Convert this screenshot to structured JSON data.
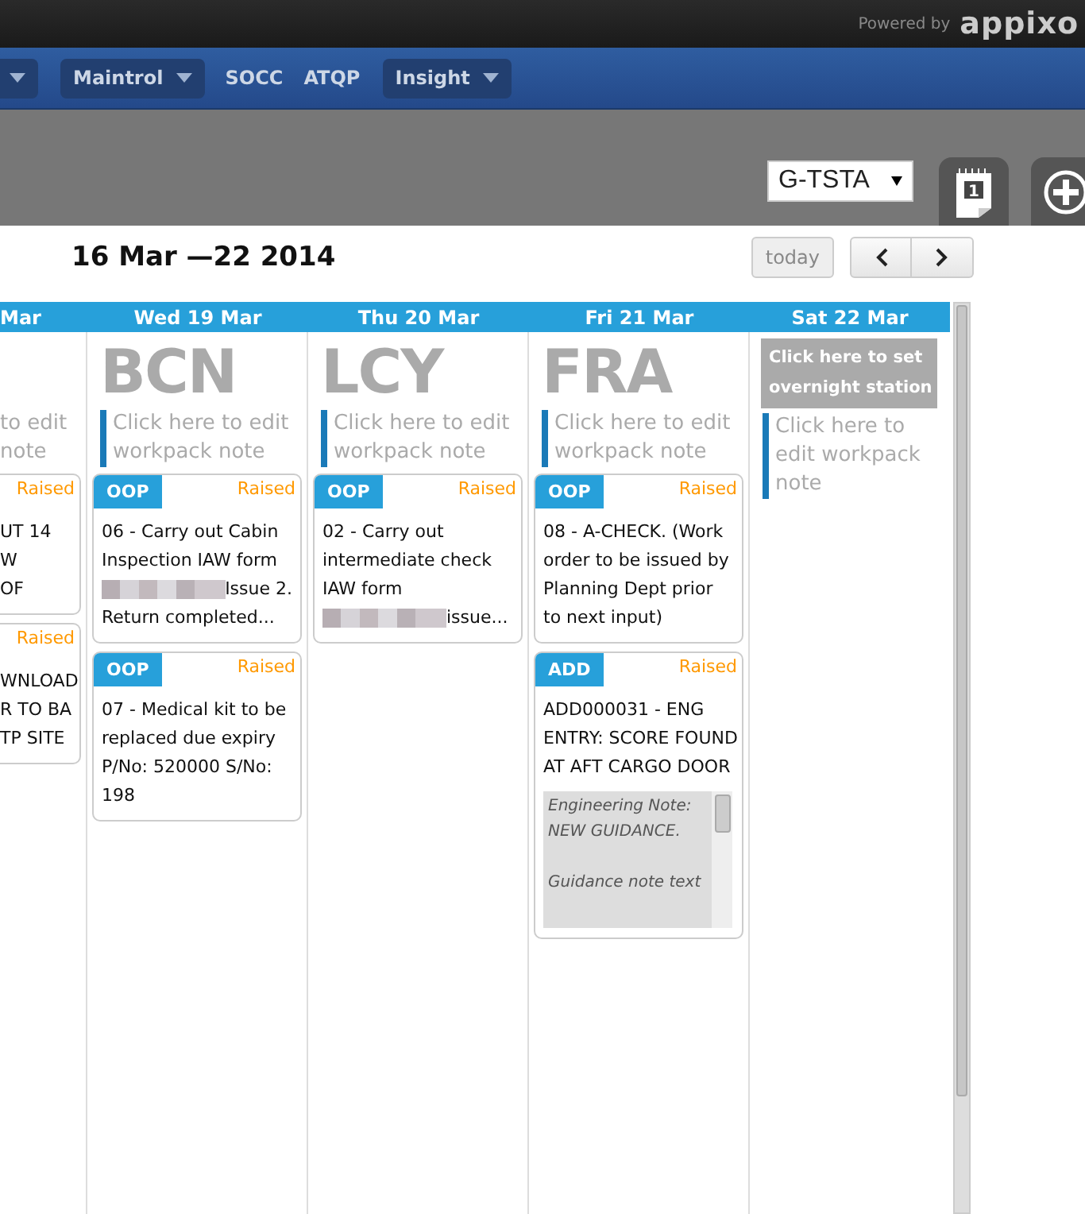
{
  "topbar": {
    "powered_by": "Powered by",
    "logo": "appixo"
  },
  "nav": [
    {
      "kind": "caret_only"
    },
    {
      "kind": "dropdown",
      "label": "Maintrol"
    },
    {
      "kind": "link",
      "label": "SOCC"
    },
    {
      "kind": "link",
      "label": "ATQP"
    },
    {
      "kind": "dropdown",
      "label": "Insight"
    }
  ],
  "toolbar": {
    "aircraft_select": "G-TSTA",
    "calendar_day": "1"
  },
  "title": "16 Mar —22 2014",
  "today_button": "today",
  "days": [
    {
      "kind": "cut",
      "header": "Mar",
      "note_lines": [
        "to edit",
        "note"
      ],
      "cards": [
        {
          "status": "Raised",
          "lines": [
            [
              "UT 14"
            ],
            [
              "W"
            ],
            [
              "OF"
            ]
          ]
        },
        {
          "status": "Raised",
          "lines": [
            [
              "WNLOAD"
            ],
            [
              "R TO BA"
            ],
            [
              "TP SITE"
            ]
          ]
        }
      ]
    },
    {
      "kind": "full",
      "header": "Wed 19 Mar",
      "station": "BCN",
      "note_lines": [
        "Click here to edit",
        "workpack note"
      ],
      "cards": [
        {
          "type": "OOP",
          "status": "Raised",
          "lines": [
            [
              "06 - Carry out Cabin"
            ],
            [
              "Inspection IAW form"
            ],
            [
              {
                "kind": "redacted"
              },
              "Issue 2."
            ],
            [
              "Return completed..."
            ]
          ]
        },
        {
          "type": "OOP",
          "status": "Raised",
          "lines": [
            [
              "07 - Medical kit to be"
            ],
            [
              "replaced due expiry"
            ],
            [
              "P/No: 520000 S/No:"
            ],
            [
              "198"
            ]
          ]
        }
      ]
    },
    {
      "kind": "full",
      "header": "Thu 20 Mar",
      "station": "LCY",
      "note_lines": [
        "Click here to edit",
        "workpack note"
      ],
      "cards": [
        {
          "type": "OOP",
          "status": "Raised",
          "lines": [
            [
              "02 - Carry out"
            ],
            [
              "intermediate check"
            ],
            [
              "IAW form"
            ],
            [
              {
                "kind": "redacted"
              },
              "issue..."
            ]
          ]
        }
      ]
    },
    {
      "kind": "full",
      "header": "Fri 21 Mar",
      "station": "FRA",
      "note_lines": [
        "Click here to edit",
        "workpack note"
      ],
      "cards": [
        {
          "type": "OOP",
          "status": "Raised",
          "lines": [
            [
              "08 - A-CHECK. (Work"
            ],
            [
              "order to be issued by"
            ],
            [
              "Planning Dept prior"
            ],
            [
              "to next input)"
            ]
          ]
        },
        {
          "type": "ADD",
          "status": "Raised",
          "lines": [
            [
              "ADD000031 - ENG"
            ],
            [
              "ENTRY: SCORE FOUND"
            ],
            [
              "AT AFT CARGO DOOR"
            ]
          ],
          "eng_note": [
            [
              "Engineering Note:",
              "NEW GUIDANCE."
            ],
            [
              "Guidance note text"
            ]
          ]
        }
      ]
    },
    {
      "kind": "narrow",
      "header": "Sat 22 Mar",
      "station_prompt": [
        "Click here to set",
        "overnight station"
      ],
      "note_lines": [
        "Click here to",
        "edit workpack",
        "note"
      ]
    }
  ]
}
